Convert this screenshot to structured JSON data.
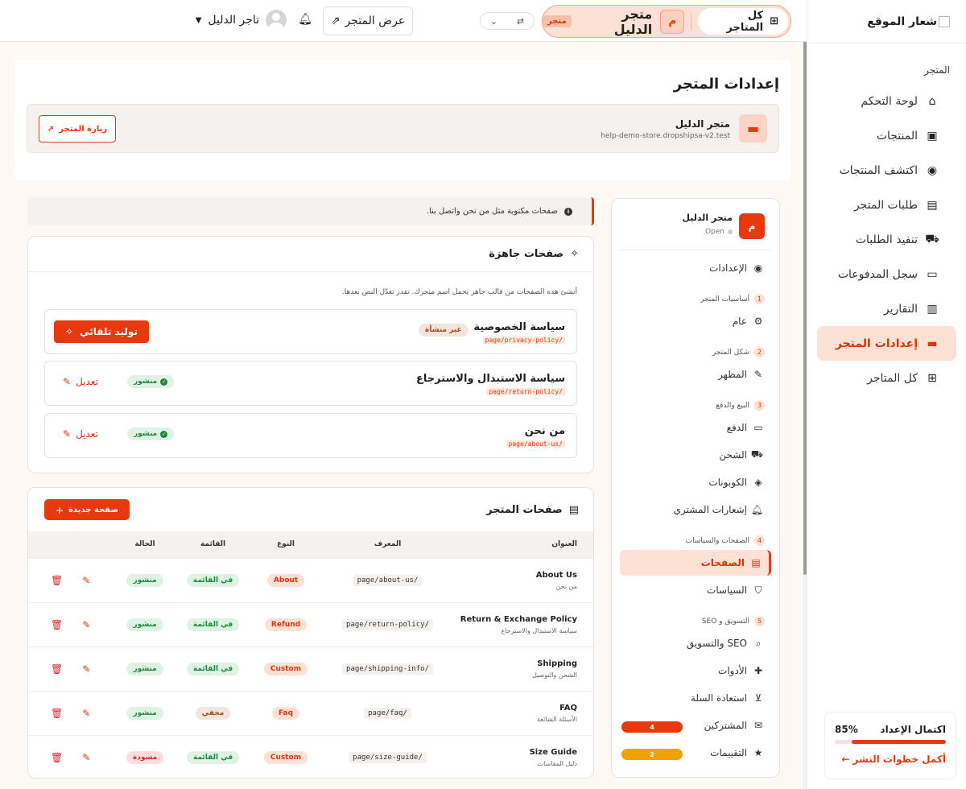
{
  "sidebar": {
    "logo": "شعار الموقع",
    "section": "المتجر",
    "items": [
      {
        "label": "لوحة التحكم",
        "icon": "home-icon"
      },
      {
        "label": "المنتجات",
        "icon": "box-icon"
      },
      {
        "label": "اكتشف المنتجات",
        "icon": "compass-icon"
      },
      {
        "label": "طلبات المتجر",
        "icon": "receipt-icon"
      },
      {
        "label": "تنفيذ الطلبات",
        "icon": "truck-icon"
      },
      {
        "label": "سجل المدفوعات",
        "icon": "money-icon"
      },
      {
        "label": "التقارير",
        "icon": "chart-icon"
      },
      {
        "label": "إعدادات المتجر",
        "icon": "store-icon",
        "active": true
      },
      {
        "label": "كل المتاجر",
        "icon": "grid-icon"
      }
    ],
    "progress": {
      "label": "اكتمال الإعداد",
      "percent": "85%",
      "value": 0.85,
      "link": "أكمل خطوات النشر ←"
    }
  },
  "topbar": {
    "all_stores": "كل المتاجر",
    "store_avatar": "م",
    "store_name": "متجر الدليل",
    "store_badge": "متجر",
    "view_store": "عرض المتجر",
    "user_name": "تاجر الدليل"
  },
  "page": {
    "title": "إعدادات المتجر",
    "store_name": "متجر الدليل",
    "store_url": "help-demo-store.dropshipsa-v2.test",
    "visit_button": "زيارة المتجر"
  },
  "subnav": {
    "avatar": "م",
    "store_name": "متجر الدليل",
    "status": "Open",
    "settings": "الإعدادات",
    "groups": [
      {
        "num": "1",
        "label": "أساسيات المتجر"
      },
      {
        "num": "2",
        "label": "شكل المتجر"
      },
      {
        "num": "3",
        "label": "البيع والدفع"
      },
      {
        "num": "4",
        "label": "الصفحات والسياسات"
      },
      {
        "num": "5",
        "label": "التسويق و SEO"
      }
    ],
    "items": {
      "general": "عام",
      "appearance": "المظهر",
      "payment": "الدفع",
      "shipping": "الشحن",
      "coupons": "الكوبونات",
      "notifications": "إشعارات المشتري",
      "pages": "الصفحات",
      "policies": "السياسات",
      "seo": "SEO والتسويق",
      "tools": "الأدوات",
      "cart_recovery": "استعادة السلة",
      "subscribers": "المشتركين",
      "reviews": "التقييمات"
    },
    "subscribers_count": "4",
    "reviews_count": "2"
  },
  "info": "صفحات مكتوبة مثل من نحن واتصل بنا.",
  "templates": {
    "title": "صفحات جاهزة",
    "desc": "أنشئ هذه الصفحات من قالب جاهز يحمل اسم متجرك. تقدر تعدّل النص بعدها.",
    "rows": [
      {
        "name": "سياسة الخصوصية",
        "slug": "/page/privacy-policy",
        "status": "غير منشأة",
        "action": "توليد تلقائي"
      },
      {
        "name": "سياسة الاستبدال والاسترجاع",
        "slug": "/page/return-policy",
        "status": "منشور",
        "action": "تعديل"
      },
      {
        "name": "من نحن",
        "slug": "/page/about-us",
        "status": "منشور",
        "action": "تعديل"
      }
    ]
  },
  "store_pages": {
    "title": "صفحات المتجر",
    "new_button": "صفحة جديدة",
    "columns": {
      "title": "العنوان",
      "slug": "المعرف",
      "type": "النوع",
      "menu": "القائمة",
      "status": "الحالة"
    },
    "rows": [
      {
        "title": "About Us",
        "subtitle": "من نحن",
        "slug": "/page/about-us",
        "type": "About",
        "menu": "في القائمة",
        "status": "منشور"
      },
      {
        "title": "Return & Exchange Policy",
        "subtitle": "سياسة الاستبدال والاسترجاع",
        "slug": "/page/return-policy",
        "type": "Refund",
        "menu": "في القائمة",
        "status": "منشور"
      },
      {
        "title": "Shipping",
        "subtitle": "الشحن والتوصيل",
        "slug": "/page/shipping-info",
        "type": "Custom",
        "menu": "في القائمة",
        "status": "منشور"
      },
      {
        "title": "FAQ",
        "subtitle": "الأسئلة الشائعة",
        "slug": "/page/faq",
        "type": "Faq",
        "menu": "مخفي",
        "status": "منشور"
      },
      {
        "title": "Size Guide",
        "subtitle": "دليل المقاسات",
        "slug": "/page/size-guide",
        "type": "Custom",
        "menu": "في القائمة",
        "status": "مسودة"
      }
    ]
  },
  "colors": {
    "accent": "#e8390e",
    "accent_light": "#fde1d5",
    "green": "#1e8a3c",
    "reviews_pill": "#f0a20c"
  }
}
